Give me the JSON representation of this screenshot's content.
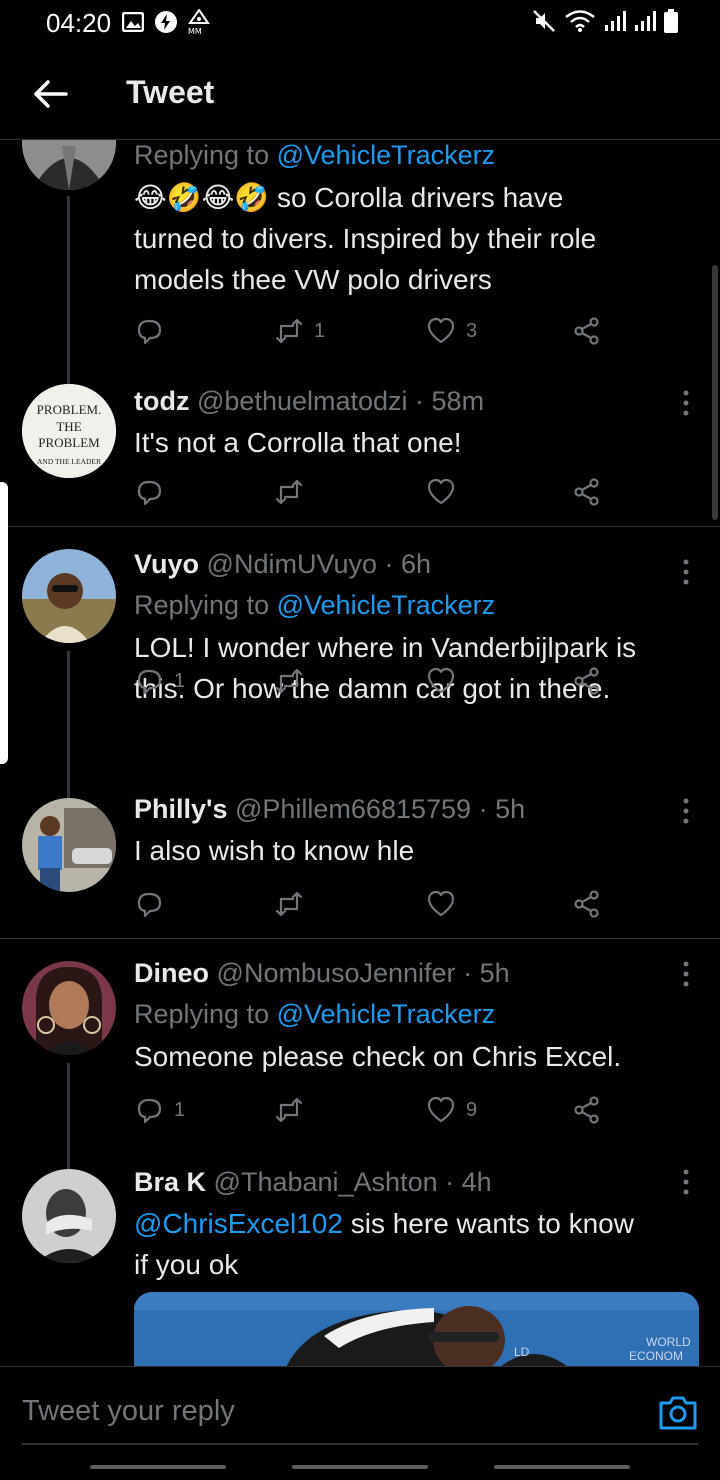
{
  "status_bar": {
    "time": "04:20"
  },
  "header": {
    "title": "Tweet"
  },
  "colors": {
    "background": "#000000",
    "text": "#e7e9ea",
    "muted": "#71767b",
    "accent": "#1d9bf0",
    "divider": "#2f3336"
  },
  "tweets": [
    {
      "replying_label": "Replying to",
      "replying_to": "@VehicleTrackerz",
      "emoji": "😂🤣😂🤣",
      "text_lines": [
        "so Corolla drivers have",
        "turned to divers. Inspired by their role",
        "models thee VW polo drivers"
      ],
      "replies": "",
      "retweets": "1",
      "likes": "3"
    },
    {
      "name": "todz",
      "handle": "@bethuelmatodzi",
      "time": "· 58m",
      "avatar_text": [
        "PROBLEM.",
        "THE",
        "PROBLEM",
        "AND THE LEADER"
      ],
      "text": "It's not a Corrolla that one!",
      "replies": "",
      "retweets": "",
      "likes": ""
    },
    {
      "name": "Vuyo",
      "handle": "@NdimUVuyo",
      "time": "· 6h",
      "replying_label": "Replying to",
      "replying_to": "@VehicleTrackerz",
      "text_lines": [
        "LOL! I wonder where in Vanderbijlpark is",
        "this. Or how the damn car got in there."
      ],
      "replies": "1",
      "retweets": "",
      "likes": ""
    },
    {
      "name": "Philly's",
      "handle": "@Phillem66815759",
      "time": "· 5h",
      "text": "I also wish to know hle",
      "replies": "",
      "retweets": "",
      "likes": ""
    },
    {
      "name": "Dineo",
      "handle": "@NombusoJennifer",
      "time": "· 5h",
      "replying_label": "Replying to",
      "replying_to": "@VehicleTrackerz",
      "text": "Someone please check on Chris Excel.",
      "replies": "1",
      "retweets": "",
      "likes": "9"
    },
    {
      "name": "Bra K",
      "handle": "@Thabani_Ashton",
      "time": "· 4h",
      "mention": "@ChrisExcel102",
      "text_after_mention": " sis here wants to know",
      "text_line2": "if you ok",
      "media_watermark": [
        "WORLD",
        "ECONOM"
      ]
    }
  ],
  "composer": {
    "placeholder": "Tweet your reply"
  }
}
